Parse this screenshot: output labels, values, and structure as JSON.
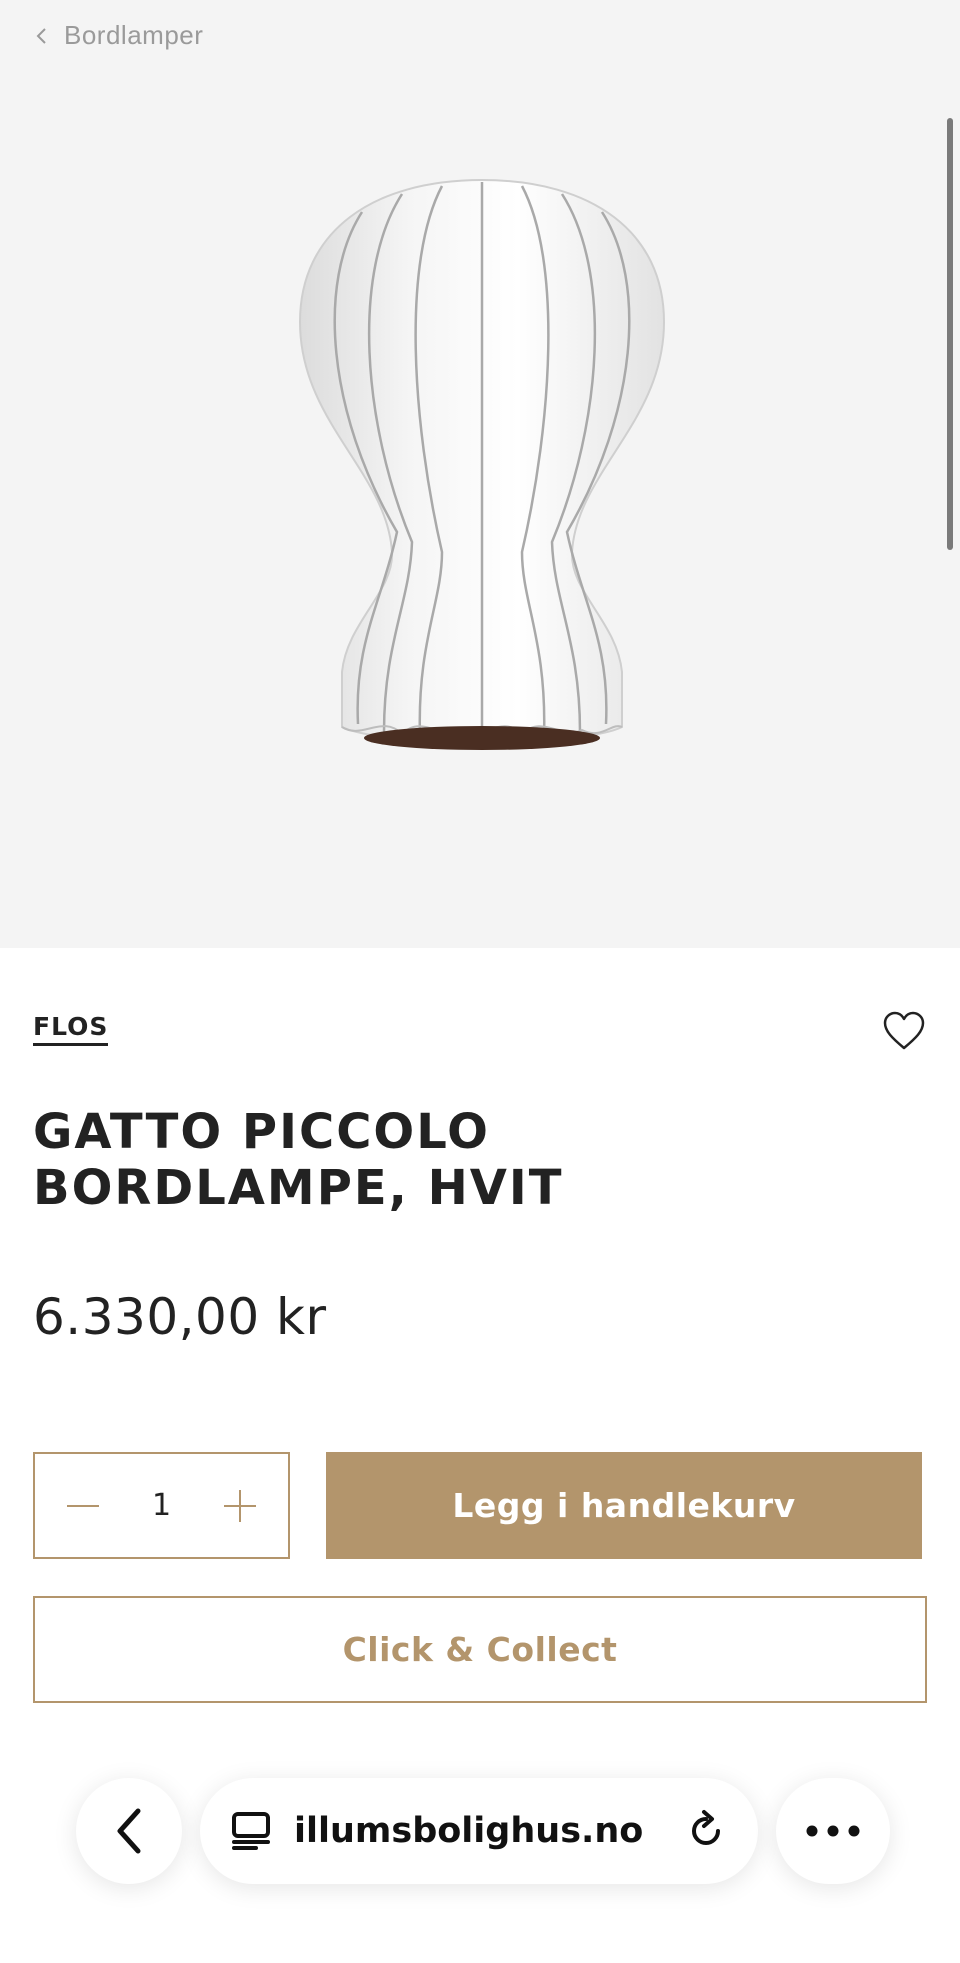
{
  "breadcrumb": {
    "label": "Bordlamper"
  },
  "product": {
    "brand": "FLOS",
    "title_line1": "GATTO PICCOLO",
    "title_line2": "BORDLAMPE, HVIT",
    "price": "6.330,00 kr",
    "image_icon": "lamp-image"
  },
  "purchase": {
    "quantity": "1",
    "add_to_cart_label": "Legg i handlekurv",
    "click_collect_label": "Click & Collect"
  },
  "browser": {
    "url": "illumsbolighus.no"
  },
  "colors": {
    "accent": "#b3956c",
    "hero_bg": "#f4f4f4",
    "text": "#222222"
  }
}
